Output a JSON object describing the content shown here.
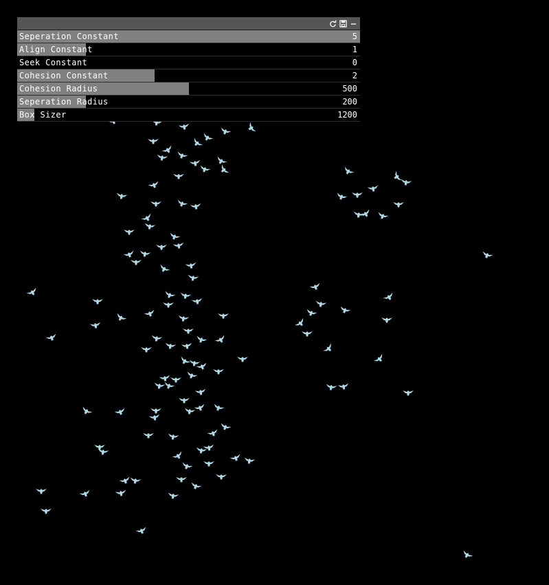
{
  "gui": {
    "header_icons": [
      "refresh-icon",
      "save-icon",
      "minimize-icon"
    ],
    "colors": {
      "header": "#555555",
      "fill": "#808080",
      "background": "#000000",
      "text": "#ffffff"
    },
    "sliders": [
      {
        "label": "Seperation Constant",
        "value": "5",
        "fill_fraction": 1.0
      },
      {
        "label": "Align Constant",
        "value": "1",
        "fill_fraction": 0.2
      },
      {
        "label": "Seek Constant",
        "value": "0",
        "fill_fraction": 0.0
      },
      {
        "label": "Cohesion Constant",
        "value": "2",
        "fill_fraction": 0.4
      },
      {
        "label": "Cohesion Radius",
        "value": "500",
        "fill_fraction": 0.5
      },
      {
        "label": "Seperation Radius",
        "value": "200",
        "fill_fraction": 0.2
      },
      {
        "label": "Box Sizer",
        "value": "1200",
        "fill_fraction": 0.05
      }
    ]
  },
  "scene": {
    "background": "#000000",
    "bird_color": "#add8e6"
  }
}
